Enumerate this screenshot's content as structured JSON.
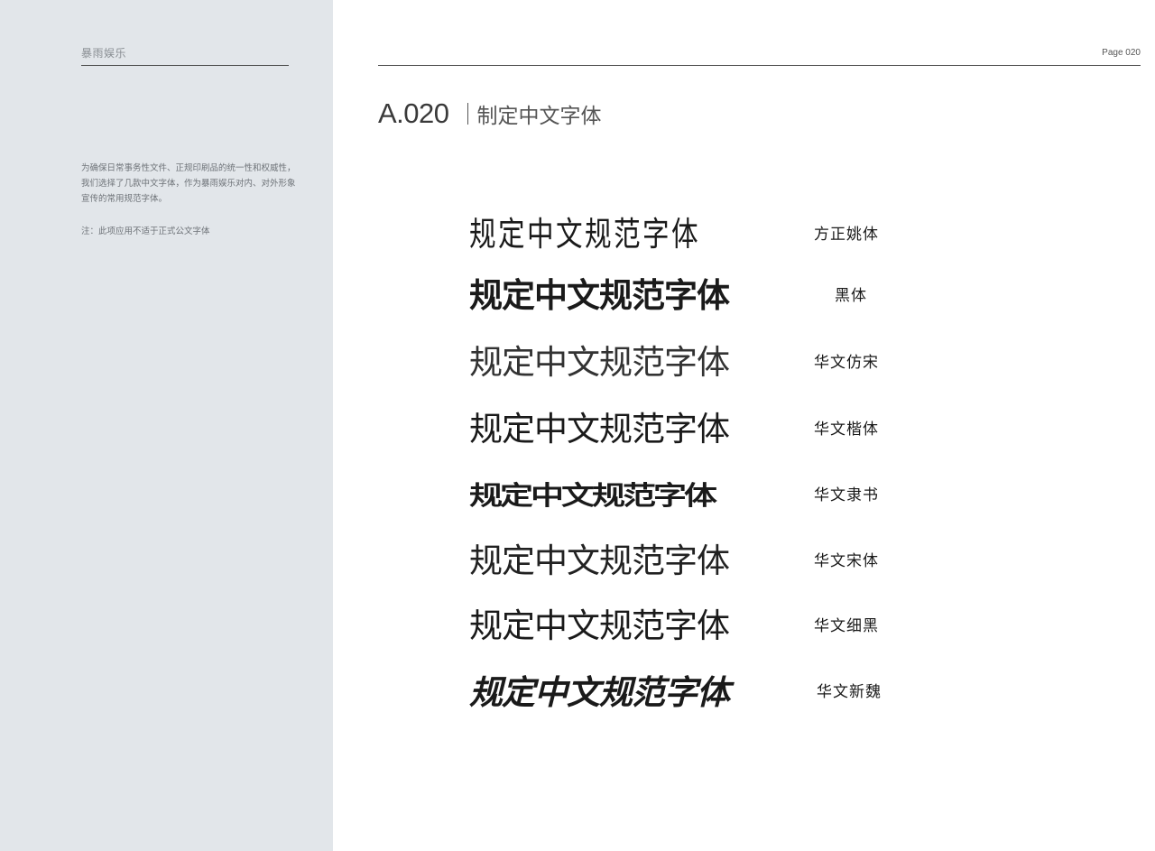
{
  "sidebar": {
    "brand": "暴雨娱乐",
    "intro": "为确保日常事务性文件、正规印刷品的统一性和权威性，我们选择了几款中文字体，作为暴雨娱乐对内、对外形象宣传的常用规范字体。",
    "note": "注：此项应用不适于正式公文字体"
  },
  "header": {
    "page": "Page 020",
    "code": "A.020",
    "title": "制定中文字体"
  },
  "fonts": [
    {
      "sample": "规定中文规范字体",
      "name": "方正姚体"
    },
    {
      "sample": "规定中文规范字体",
      "name": "黑体"
    },
    {
      "sample": "规定中文规范字体",
      "name": "华文仿宋"
    },
    {
      "sample": "规定中文规范字体",
      "name": "华文楷体"
    },
    {
      "sample": "规定中文规范字体",
      "name": "华文隶书"
    },
    {
      "sample": "规定中文规范字体",
      "name": "华文宋体"
    },
    {
      "sample": "规定中文规范字体",
      "name": "华文细黑"
    },
    {
      "sample": "规定中文规范字体",
      "name": "华文新魏"
    }
  ]
}
